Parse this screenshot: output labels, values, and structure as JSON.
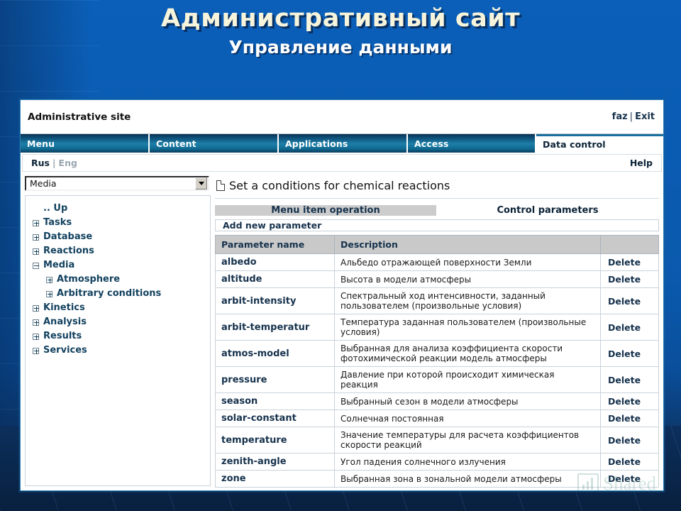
{
  "slide": {
    "title": "Административный сайт",
    "subtitle": "Управление данными"
  },
  "app": {
    "title": "Administrative site",
    "user_link": "faz",
    "separator": "|",
    "exit_link": "Exit"
  },
  "tabs": [
    {
      "label": "Menu",
      "active": false
    },
    {
      "label": "Content",
      "active": false
    },
    {
      "label": "Applications",
      "active": false
    },
    {
      "label": "Access",
      "active": false
    },
    {
      "label": "Data control",
      "active": true
    }
  ],
  "lang_bar": {
    "active": "Rus",
    "separator": "|",
    "inactive": "Eng",
    "help": "Help"
  },
  "sidebar": {
    "select_value": "Media",
    "tree": [
      {
        "label": ".. Up",
        "icon": "none",
        "level": 0
      },
      {
        "label": "Tasks",
        "icon": "plus",
        "level": 0
      },
      {
        "label": "Database",
        "icon": "plus",
        "level": 0
      },
      {
        "label": "Reactions",
        "icon": "plus",
        "level": 0
      },
      {
        "label": "Media",
        "icon": "minus",
        "level": 0
      },
      {
        "label": "Atmosphere",
        "icon": "plus",
        "level": 1
      },
      {
        "label": "Arbitrary conditions",
        "icon": "plus",
        "level": 1
      },
      {
        "label": "Kinetics",
        "icon": "plus",
        "level": 0
      },
      {
        "label": "Analysis",
        "icon": "plus",
        "level": 0
      },
      {
        "label": "Results",
        "icon": "plus",
        "level": 0
      },
      {
        "label": "Services",
        "icon": "plus",
        "level": 0
      }
    ]
  },
  "content": {
    "page_title": "Set a conditions for chemical reactions",
    "subtab_primary": "Menu item operation",
    "subtab_secondary": "Control parameters",
    "add_new": "Add new parameter",
    "table": {
      "headers": [
        "Parameter name",
        "Description",
        ""
      ],
      "rows": [
        {
          "name": "albedo",
          "description": "Альбедо отражающей поверхности Земли",
          "action": "Delete"
        },
        {
          "name": "altitude",
          "description": "Высота в модели атмосферы",
          "action": "Delete"
        },
        {
          "name": "arbit-intensity",
          "description": "Спектральный ход интенсивности, заданный пользователем (произвольные условия)",
          "action": "Delete"
        },
        {
          "name": "arbit-temperatur",
          "description": "Температура заданная пользователем (произвольные условия)",
          "action": "Delete"
        },
        {
          "name": "atmos-model",
          "description": "Выбранная для анализа коэффициента скорости фотохимической реакции модель атмосферы",
          "action": "Delete"
        },
        {
          "name": "pressure",
          "description": "Давление при которой происходит химическая реакция",
          "action": "Delete"
        },
        {
          "name": "season",
          "description": "Выбранный сезон в модели атмосферы",
          "action": "Delete"
        },
        {
          "name": "solar-constant",
          "description": "Солнечная постоянная",
          "action": "Delete"
        },
        {
          "name": "temperature",
          "description": "Значение температуры для расчета коэффициентов скорости реакций",
          "action": "Delete"
        },
        {
          "name": "zenith-angle",
          "description": "Угол падения солнечного излучения",
          "action": "Delete"
        },
        {
          "name": "zone",
          "description": "Выбранная зона в зональной модели атмосферы",
          "action": "Delete"
        }
      ]
    }
  },
  "watermark": {
    "text": "Shared"
  },
  "colors": {
    "slide_bg": "#0b5fb8",
    "title_text": "#f7f4dc",
    "tab_blue": "#1d7fa8",
    "link_dark": "#16324d",
    "header_gray": "#c9c9c9",
    "subtab_gray": "#cccccc"
  }
}
